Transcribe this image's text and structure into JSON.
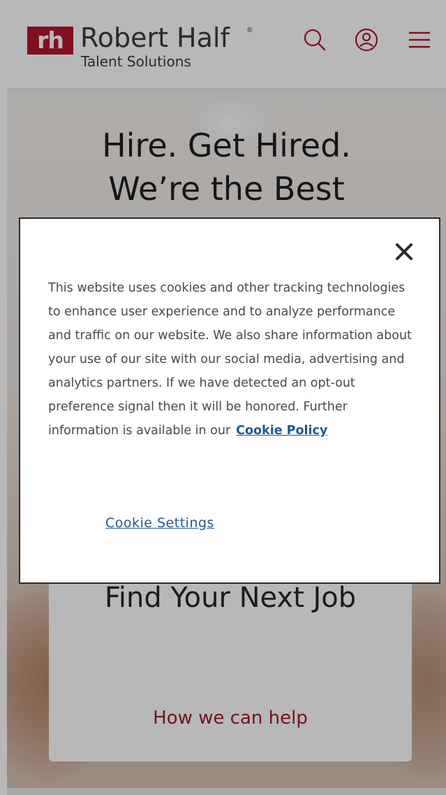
{
  "header": {
    "logo_mark": "rh",
    "logo_name": "Robert Half",
    "logo_registered": "®",
    "logo_sub": "Talent Solutions",
    "icons": [
      "search-icon",
      "account-icon",
      "menu-icon"
    ],
    "brand_color": "#b3152c"
  },
  "hero": {
    "title_line1": "Hire. Get Hired.",
    "title_line2": "We’re the Best"
  },
  "job_card": {
    "title": "Find Your Next Job",
    "link": "How we can help"
  },
  "cookie": {
    "body": "This website uses cookies and other tracking technologies to enhance user experience and to analyze performance and traffic on our website. We also share information about your use of our site with our social media, advertising and analytics partners. If we have detected an opt-out preference signal then it will be honored. Further information is available in our",
    "policy_link": "Cookie Policy",
    "settings_link": "Cookie Settings",
    "close_icon": "close-icon",
    "link_color": "#1f5a8c"
  }
}
